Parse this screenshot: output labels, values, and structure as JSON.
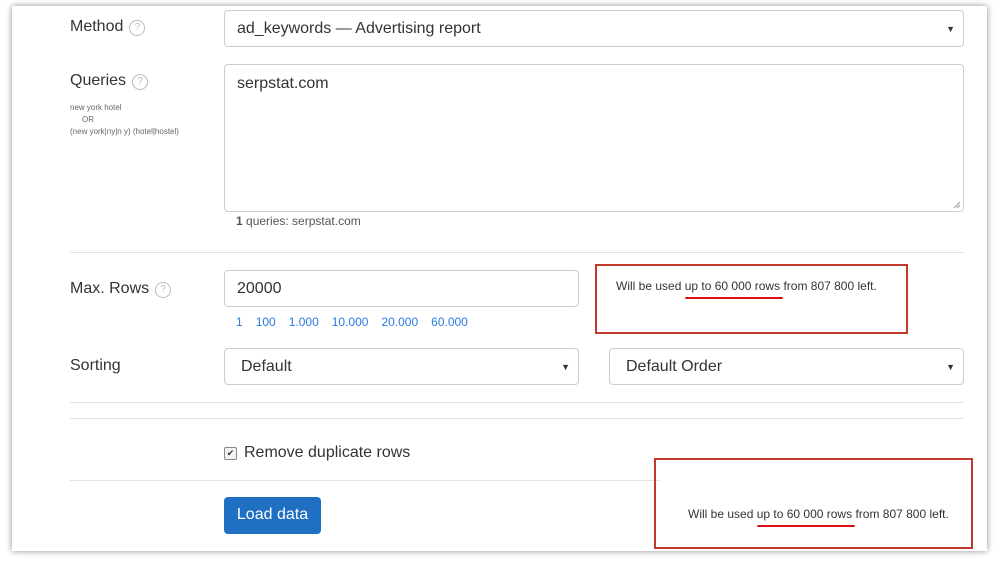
{
  "method": {
    "label": "Method",
    "value": "ad_keywords — Advertising report"
  },
  "queries": {
    "label": "Queries",
    "hints": [
      "new york hotel",
      "OR",
      "(new york|ny|n y) (hotel|hostel)"
    ],
    "value": "serpstat.com",
    "count": "1",
    "count_text": " queries: serpstat.com"
  },
  "max_rows": {
    "label": "Max. Rows",
    "value": "20000",
    "quick": [
      "1",
      "100",
      "1.000",
      "10.000",
      "20.000",
      "60.000"
    ],
    "note_pre": "Will be used ",
    "note_highlight": "up to 60 000 rows",
    "note_post": " from 807 800 left."
  },
  "sorting": {
    "label": "Sorting",
    "field": "Default",
    "order": "Default Order"
  },
  "remove_duplicates": {
    "label": "Remove duplicate rows",
    "checked": true
  },
  "load_button": "Load data",
  "bottom_note": {
    "pre": "Will be used ",
    "highlight": "up to 60 000 rows",
    "post": " from 807 800 left."
  },
  "icons": {
    "help": "question-circle-icon",
    "caret": "caret-down-icon",
    "check": "checkmark-icon"
  },
  "colors": {
    "accent": "#1f6fc2",
    "link": "#2a7ae2",
    "annotation_red": "#c0392b"
  }
}
